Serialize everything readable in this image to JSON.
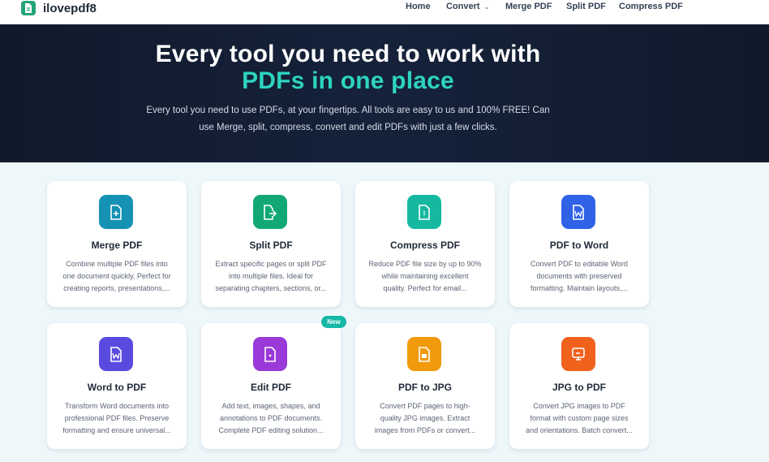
{
  "brand": {
    "name": "ilovepdf8",
    "color": "#23a47c"
  },
  "nav": {
    "home": "Home",
    "convert": "Convert",
    "merge": "Merge PDF",
    "split": "Split PDF",
    "compress": "Compress PDF"
  },
  "hero": {
    "title_line1": "Every tool you need to work with",
    "title_line2": "PDFs in one place",
    "subtitle_line1": "Every tool you need to use PDFs, at your fingertips. All tools are easy to us and 100% FREE! Can",
    "subtitle_line2": "use Merge, split, compress, convert and edit PDFs with just a few clicks.",
    "accent_color": "#2dd4bf"
  },
  "tools": [
    {
      "title": "Merge PDF",
      "icon": "file-plus-icon",
      "color": "#1491b3",
      "desc": [
        "Combine multiple PDF files into",
        "one document quickly. Perfect for",
        "creating reports, presentations,..."
      ]
    },
    {
      "title": "Split PDF",
      "icon": "file-split-icon",
      "color": "#12a874",
      "desc": [
        "Extract specific pages or split PDF",
        "into multiple files. Ideal for",
        "separating chapters, sections, or..."
      ]
    },
    {
      "title": "Compress PDF",
      "icon": "file-compress-icon",
      "color": "#16b8a0",
      "desc": [
        "Reduce PDF file size by up to 90%",
        "while maintaining excellent",
        "quality. Perfect for email..."
      ]
    },
    {
      "title": "PDF to Word",
      "icon": "word-file-icon",
      "color": "#2f62e6",
      "desc": [
        "Convert PDF to editable Word",
        "documents with preserved",
        "formatting. Maintain layouts,..."
      ]
    },
    {
      "title": "Word to PDF",
      "icon": "word-file-icon",
      "color": "#5a4be0",
      "desc": [
        "Transform Word documents into",
        "professional PDF files. Preserve",
        "formatting and ensure universal..."
      ]
    },
    {
      "title": "Edit PDF",
      "icon": "file-edit-icon",
      "color": "#9a3ad9",
      "desc": [
        "Add text, images, shapes, and",
        "annotations to PDF documents.",
        "Complete PDF editing solution..."
      ]
    },
    {
      "title": "PDF to JPG",
      "icon": "image-file-icon",
      "color": "#f19a0c",
      "desc": [
        "Convert PDF pages to high-",
        "quality JPG images. Extract",
        "images from PDFs or convert..."
      ]
    },
    {
      "title": "JPG to PDF",
      "icon": "image-to-pdf-icon",
      "color": "#f0611c",
      "desc": [
        "Convert JPG images to PDF",
        "format with custom page sizes",
        "and orientations. Batch convert..."
      ]
    }
  ],
  "badge": {
    "label": "New",
    "color": "#14b8a6"
  }
}
